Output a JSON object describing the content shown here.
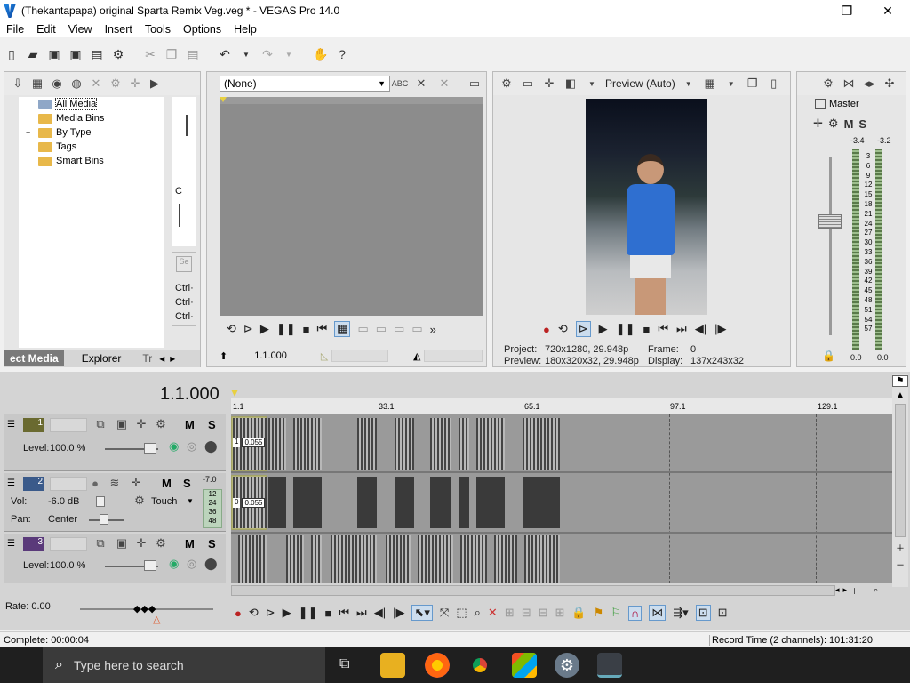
{
  "window": {
    "title": "(Thekantapapa) original Sparta Remix Veg.veg * - VEGAS Pro 14.0",
    "minimize": "—",
    "maximize": "❐",
    "close": "✕"
  },
  "menu": [
    "File",
    "Edit",
    "View",
    "Insert",
    "Tools",
    "Options",
    "Help"
  ],
  "media": {
    "tree": [
      "All Media",
      "Media Bins",
      "By Type",
      "Tags",
      "Smart Bins"
    ],
    "expand": "+",
    "tabs": [
      "ect Media",
      "Explorer",
      "Tr"
    ],
    "side_text": [
      "C",
      "Ctrl·",
      "Ctrl·",
      "Ctrl·"
    ]
  },
  "trimmer": {
    "dropdown": "(None)",
    "timecode": "1.1.000"
  },
  "preview": {
    "mode": "Preview (Auto)",
    "project_label": "Project:",
    "project_value": "720x1280, 29.948p",
    "preview_label": "Preview:",
    "preview_value": "180x320x32, 29.948p",
    "frame_label": "Frame:",
    "frame_value": "0",
    "display_label": "Display:",
    "display_value": "137x243x32"
  },
  "master": {
    "label": "Master",
    "m": "M",
    "s": "S",
    "peak_l": "-3.4",
    "peak_r": "-3.2",
    "scale": [
      "3",
      "6",
      "9",
      "12",
      "15",
      "18",
      "21",
      "24",
      "27",
      "30",
      "33",
      "36",
      "39",
      "42",
      "45",
      "48",
      "51",
      "54",
      "57"
    ],
    "out_l": "0.0",
    "out_r": "0.0"
  },
  "timeline": {
    "timecode": "1.1.000",
    "markers": [
      "1.1",
      "33.1",
      "65.1",
      "97.1",
      "129.1"
    ],
    "tracks": [
      {
        "num": "1",
        "level_label": "Level:",
        "level": "100.0 %",
        "m": "M",
        "s": "S"
      },
      {
        "num": "2",
        "vol_label": "Vol:",
        "vol": "-6.0 dB",
        "pan_label": "Pan:",
        "pan": "Center",
        "touch": "Touch",
        "m": "M",
        "s": "S",
        "meter_top": "-7.0",
        "meter_scale": [
          "12",
          "24",
          "36",
          "48"
        ]
      },
      {
        "num": "3",
        "level_label": "Level:",
        "level": "100.0 %",
        "m": "M",
        "s": "S"
      }
    ],
    "clip_label_v": "1",
    "clip_val_v": "0.055",
    "clip_label_a": "0",
    "clip_val_a": "0.055",
    "rate": "Rate: 0.00"
  },
  "status": {
    "complete": "Complete: 00:00:04",
    "record": "Record Time (2 channels): 101:31:20"
  },
  "taskbar": {
    "search_placeholder": "Type here to search"
  },
  "colors": {
    "accent": "#0078d7",
    "clip_yellow": "#c8c860"
  }
}
